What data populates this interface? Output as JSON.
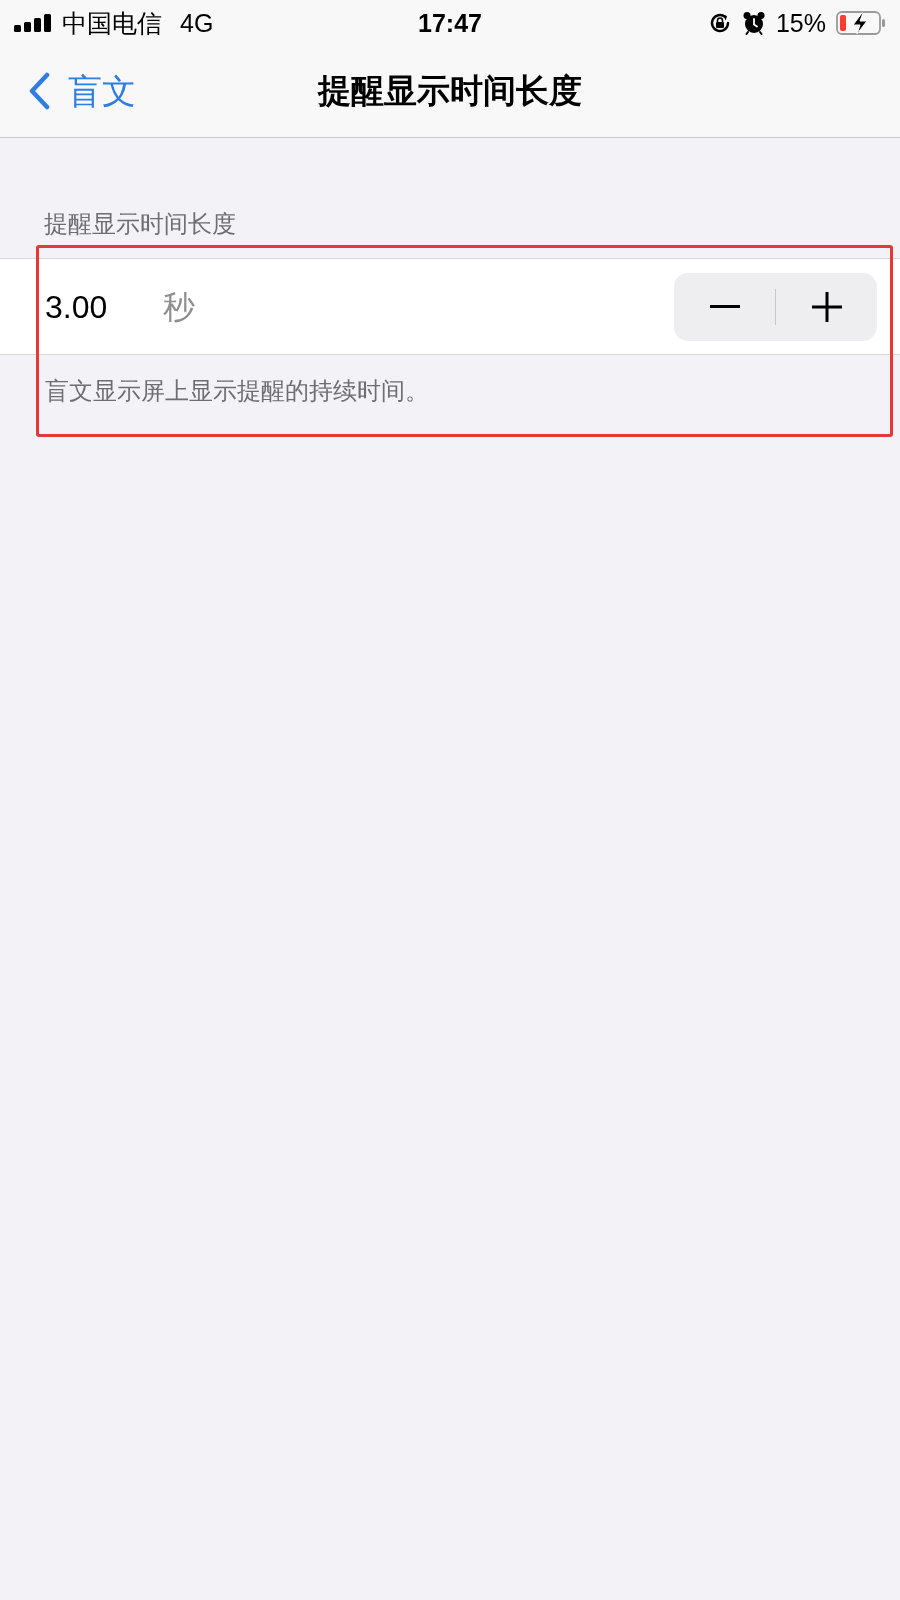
{
  "status_bar": {
    "carrier": "中国电信",
    "network": "4G",
    "time": "17:47",
    "battery_percent": "15%",
    "charging": true
  },
  "nav_bar": {
    "back_label": "盲文",
    "title": "提醒显示时间长度"
  },
  "section": {
    "header": "提醒显示时间长度",
    "value": "3.00",
    "unit": "秒",
    "footer": "盲文显示屏上显示提醒的持续时间。",
    "highlighted": true
  }
}
